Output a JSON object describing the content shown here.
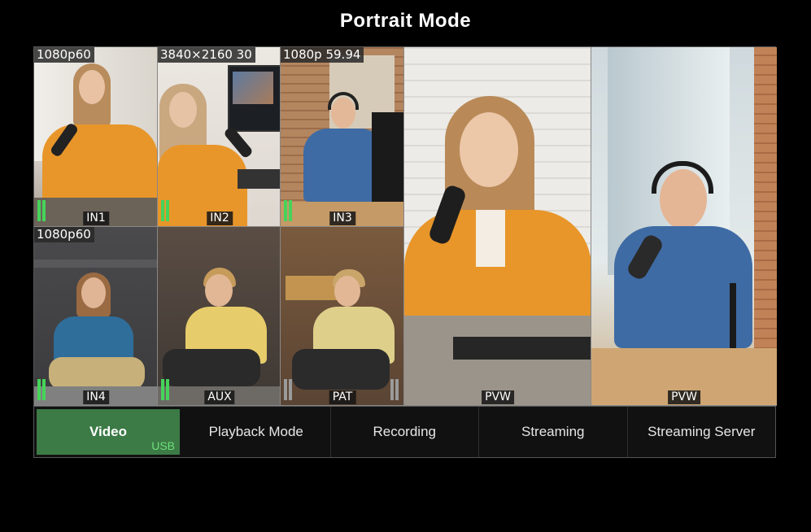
{
  "page": {
    "title": "Portrait Mode"
  },
  "inputs": [
    {
      "resolution": "1080p60",
      "label": "IN1"
    },
    {
      "resolution": "3840×2160 30",
      "label": "IN2"
    },
    {
      "resolution": "1080p 59.94",
      "label": "IN3"
    },
    {
      "resolution": "1080p60",
      "label": "IN4"
    },
    {
      "resolution": "",
      "label": "AUX"
    },
    {
      "resolution": "",
      "label": "PAT"
    }
  ],
  "previews": [
    {
      "label": "PVW"
    },
    {
      "label": "PVW"
    }
  ],
  "tabs": [
    {
      "label": "Video",
      "sub": "USB"
    },
    {
      "label": "Playback Mode"
    },
    {
      "label": "Recording"
    },
    {
      "label": "Streaming"
    },
    {
      "label": "Streaming Server"
    }
  ],
  "colors": {
    "accent": "#3c7a46",
    "meter": "#46d35a",
    "sub_label": "#6ee07a"
  }
}
